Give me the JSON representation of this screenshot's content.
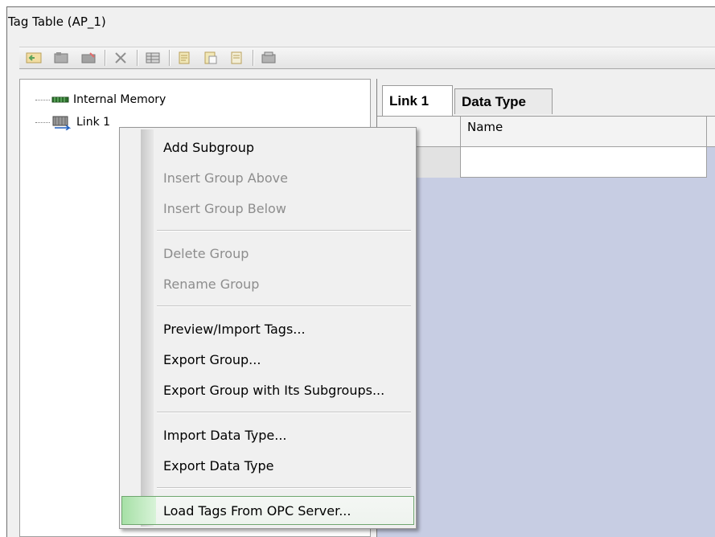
{
  "window": {
    "title": "Tag Table (AP_1)"
  },
  "toolbar": {
    "buttons": [
      {
        "icon": "new-group-icon"
      },
      {
        "icon": "tags-icon"
      },
      {
        "icon": "edit-icon"
      },
      {
        "icon": "delete-icon"
      },
      {
        "icon": "table-icon"
      },
      {
        "icon": "copy-icon"
      },
      {
        "icon": "paste-icon"
      },
      {
        "icon": "page-icon"
      },
      {
        "icon": "device-icon"
      }
    ]
  },
  "tree": {
    "items": [
      {
        "label": "Internal Memory",
        "icon": "memory-icon"
      },
      {
        "label": "Link 1",
        "icon": "link-device-icon"
      }
    ]
  },
  "tabs": {
    "active": "Link 1",
    "items": [
      "Link 1",
      "Data Type"
    ]
  },
  "grid": {
    "columns": [
      "",
      "Name"
    ]
  },
  "context_menu": {
    "items": [
      {
        "label": "Add Subgroup",
        "enabled": true
      },
      {
        "label": "Insert Group Above",
        "enabled": false
      },
      {
        "label": "Insert Group Below",
        "enabled": false
      },
      {
        "label": "Delete Group",
        "enabled": false
      },
      {
        "label": "Rename Group",
        "enabled": false
      },
      {
        "label": "Preview/Import Tags...",
        "enabled": true
      },
      {
        "label": "Export Group...",
        "enabled": true
      },
      {
        "label": "Export Group with Its Subgroups...",
        "enabled": true
      },
      {
        "label": "Import Data Type...",
        "enabled": true
      },
      {
        "label": "Export Data Type",
        "enabled": true
      },
      {
        "label": "Load Tags From OPC Server...",
        "enabled": true,
        "highlighted": true
      }
    ]
  },
  "colors": {
    "grid_background": "#c7cde3",
    "highlight_border": "#6fa66f",
    "highlight_gutter": "#a6e0a6"
  }
}
